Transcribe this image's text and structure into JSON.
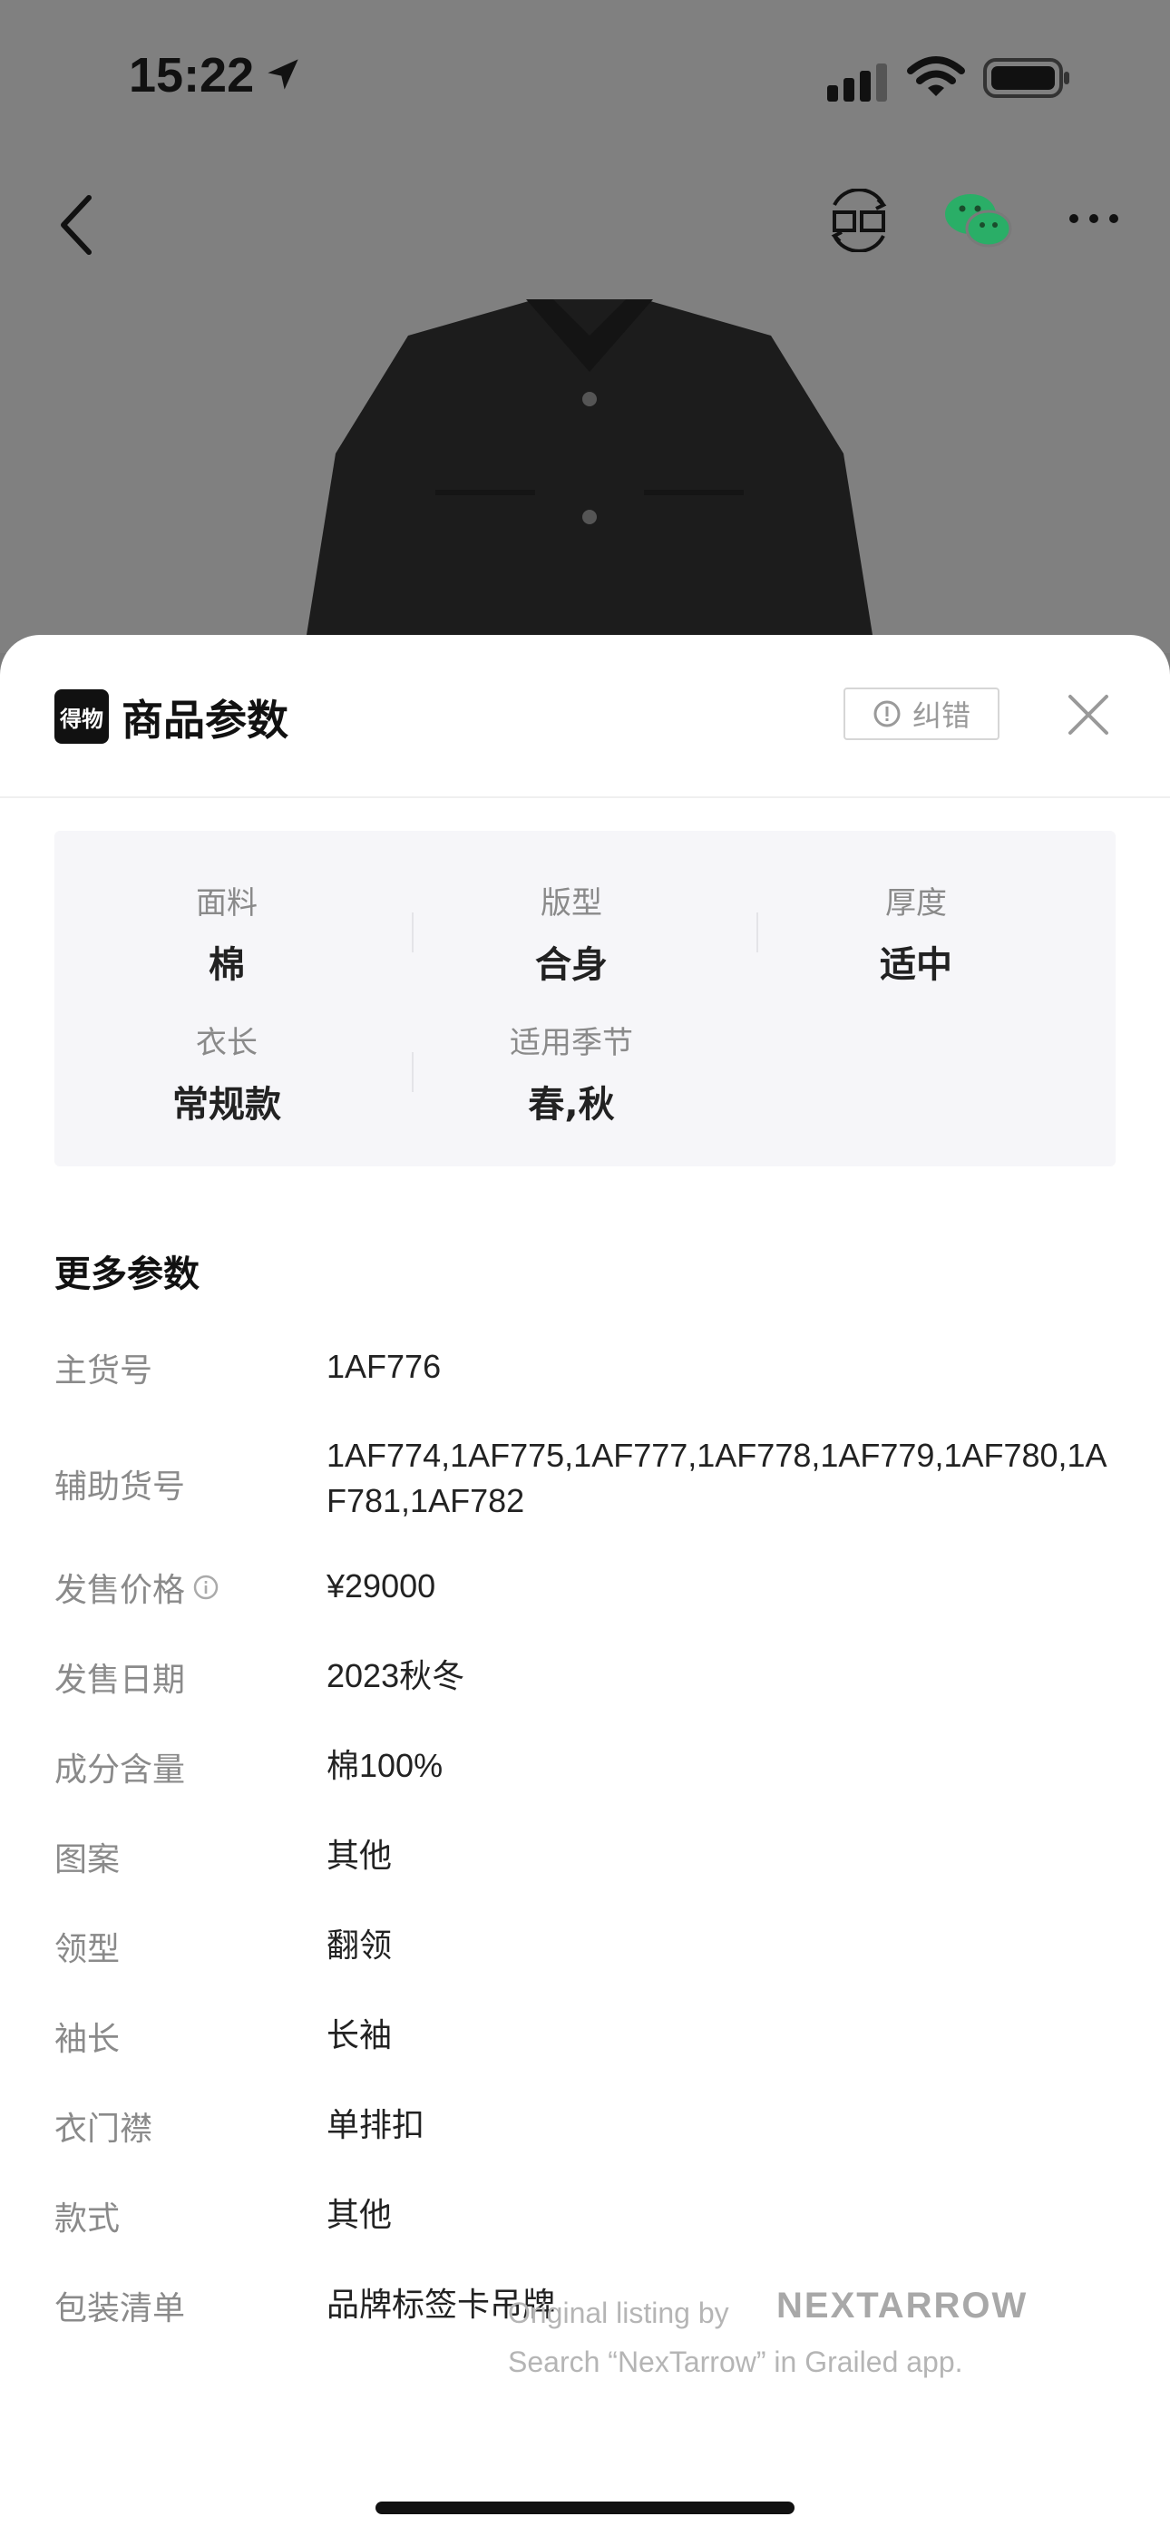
{
  "status": {
    "time": "15:22"
  },
  "sheet": {
    "title": "商品参数",
    "logo_text": "得物",
    "report_label": "纠错"
  },
  "attributes": [
    {
      "label": "面料",
      "value": "棉"
    },
    {
      "label": "版型",
      "value": "合身"
    },
    {
      "label": "厚度",
      "value": "适中"
    },
    {
      "label": "衣长",
      "value": "常规款"
    },
    {
      "label": "适用季节",
      "value": "春,秋"
    }
  ],
  "more": {
    "title": "更多参数",
    "params": [
      {
        "label": "主货号",
        "value": "1AF776"
      },
      {
        "label": "辅助货号",
        "value": "1AF774,1AF775,1AF777,1AF778,1AF779,1AF780,1AF781,1AF782"
      },
      {
        "label": "发售价格",
        "value": "¥29000"
      },
      {
        "label": "发售日期",
        "value": "2023秋冬"
      },
      {
        "label": "成分含量",
        "value": "棉100%"
      },
      {
        "label": "图案",
        "value": "其他"
      },
      {
        "label": "领型",
        "value": "翻领"
      },
      {
        "label": "袖长",
        "value": "长袖"
      },
      {
        "label": "衣门襟",
        "value": "单排扣"
      },
      {
        "label": "款式",
        "value": "其他"
      },
      {
        "label": "包装清单",
        "value": "品牌标签卡吊牌"
      }
    ]
  },
  "watermark": {
    "line1": "Original listing by",
    "brand": "NEXTARROW",
    "line2": "Search “NexTarrow” in Grailed app."
  },
  "icons": {
    "location": "location-arrow-icon",
    "signal": "cellular-signal-icon",
    "wifi": "wifi-icon",
    "battery": "battery-icon",
    "back": "chevron-left-icon",
    "sell": "sell-icon",
    "wechat": "wechat-icon",
    "more": "more-dots-icon",
    "report": "exclamation-circle-icon",
    "close": "close-icon",
    "info": "info-icon"
  },
  "colors": {
    "wechat": "#2aae67",
    "jacket": "#1c1c1c"
  }
}
